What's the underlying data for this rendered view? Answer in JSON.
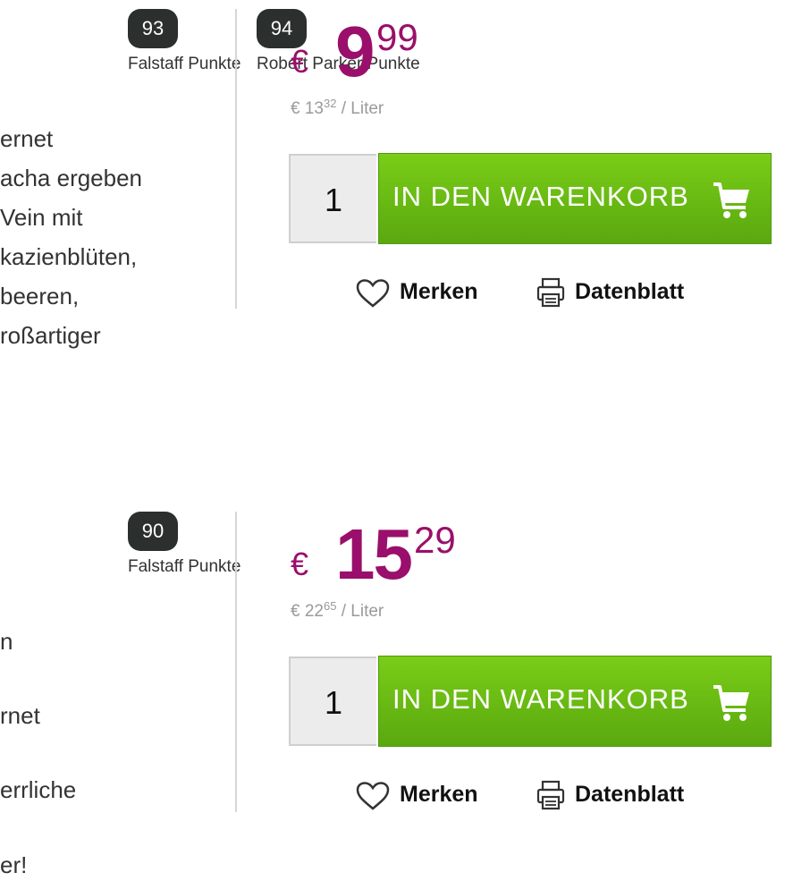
{
  "products": [
    {
      "description_lines": [
        "ernet",
        "acha ergeben",
        "Vein mit",
        "kazienblüten,",
        "beeren,",
        "roßartiger"
      ],
      "ratings": [
        {
          "score": "93",
          "label": "Falstaff Punkte"
        },
        {
          "score": "94",
          "label": "Robert Parker Punkte"
        }
      ],
      "price": {
        "currency": "€",
        "int": "9",
        "dec": "99"
      },
      "unit_price": {
        "prefix": "€ 13",
        "dec": "32",
        "suffix": " / Liter"
      },
      "qty": "1",
      "cart_label": "IN DEN WARENKORB",
      "merken": "Merken",
      "datenblatt": "Datenblatt"
    },
    {
      "description_lines": [
        "n",
        "rnet",
        "errliche",
        "er!"
      ],
      "ratings": [
        {
          "score": "90",
          "label": "Falstaff Punkte"
        }
      ],
      "price": {
        "currency": "€",
        "int": "15",
        "dec": "29"
      },
      "unit_price": {
        "prefix": "€ 22",
        "dec": "65",
        "suffix": " / Liter"
      },
      "qty": "1",
      "cart_label": "IN DEN WARENKORB",
      "merken": "Merken",
      "datenblatt": "Datenblatt"
    }
  ],
  "colors": {
    "price": "#9a0f6b",
    "cart_button": "#6bbf12",
    "badge": "#2b2f2d"
  },
  "icons": {
    "cart": "shopping-cart-icon",
    "heart": "heart-icon",
    "printer": "printer-icon"
  }
}
